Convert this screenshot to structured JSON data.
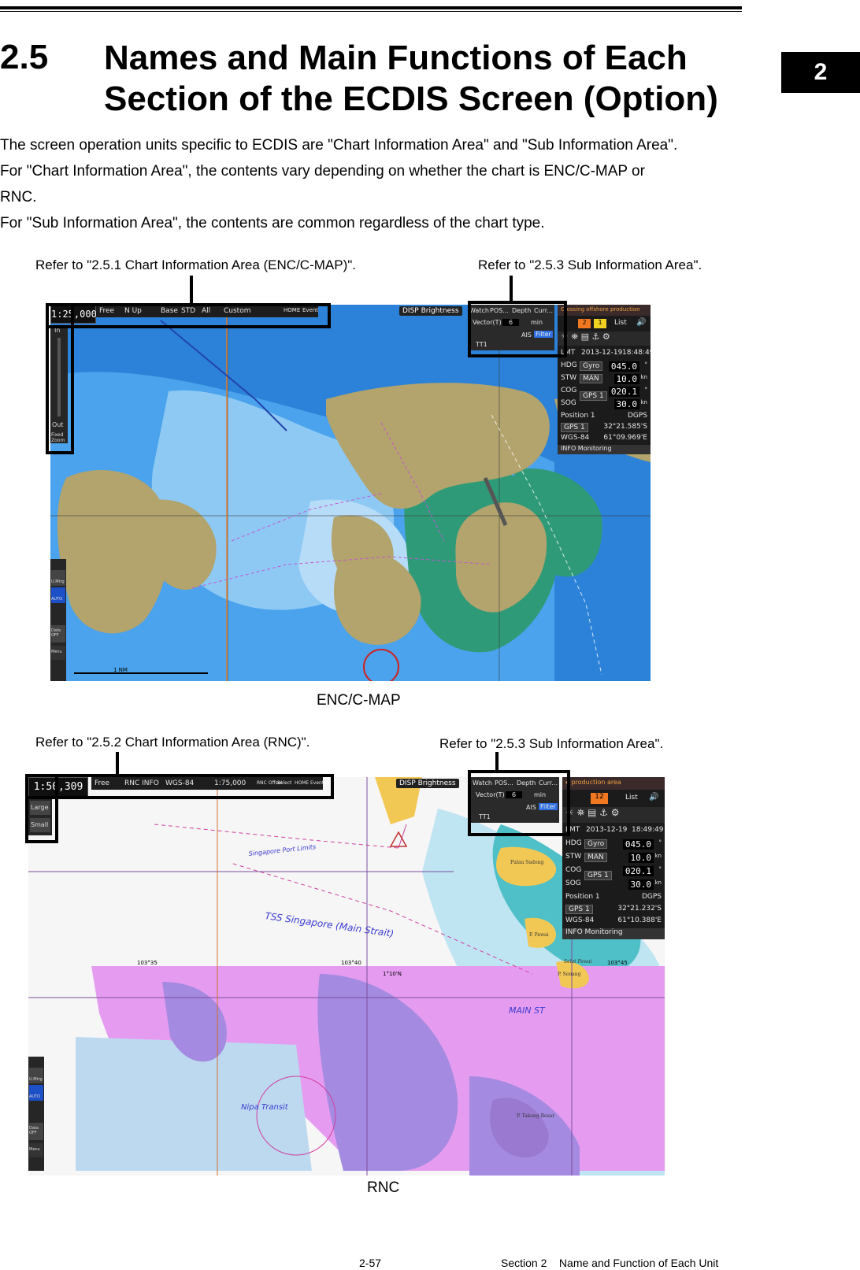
{
  "chapter_tab": "2",
  "heading": {
    "number": "2.5",
    "title": "Names and Main Functions of Each Section of the ECDIS Screen (Option)"
  },
  "paragraphs": [
    "The screen operation units specific to ECDIS are \"Chart Information Area\" and \"Sub Information Area\".",
    "For \"Chart Information Area\", the contents vary depending on whether the chart is ENC/C-MAP or",
    "RNC.",
    "For \"Sub Information Area\", the contents are common regardless of the chart type."
  ],
  "figure1": {
    "callout_left": "Refer to \"2.5.1 Chart Information Area (ENC/C-MAP)\".",
    "callout_right": "Refer to \"2.5.3 Sub Information Area\".",
    "caption": "ENC/C-MAP",
    "toolbar": {
      "scale": "1:25,000",
      "items": [
        "Free",
        "N Up",
        "Base",
        "STD",
        "All",
        "Custom"
      ],
      "icons": [
        "HOME",
        "Event"
      ]
    },
    "zoom": {
      "in": "In",
      "out": "Out",
      "fixed": "Fixed Zoom"
    },
    "brightness": "DISP Brightness",
    "alert_text": "Crossing offshore production",
    "watch": {
      "tabs": [
        "Watch",
        "POS...",
        "Depth",
        "Curr..."
      ],
      "vector": "Vector(T)",
      "vector_val": "6",
      "vector_unit": "min",
      "ais": "AIS",
      "filter": "Filter",
      "tt": "TT1"
    },
    "alarm_counts": [
      "2",
      "1"
    ],
    "list": "List",
    "sensor": {
      "time_label": "LMT",
      "date": "2013-12-19",
      "time": "18:48:49",
      "hdg_src": "Gyro",
      "hdg": "045.0",
      "hdg_u": "°",
      "stw_src": "MAN",
      "stw": "10.0",
      "stw_u": "kn",
      "cog_src": "GPS 1",
      "cog": "020.1",
      "cog_u": "°",
      "sog": "30.0",
      "sog_u": "kn",
      "pos_label": "Position 1",
      "pos_type": "DGPS",
      "gps": "GPS 1",
      "lat": "32°21.585'S",
      "datum": "WGS-84",
      "lon": "61°09.969'E",
      "info": "INFO Monitoring"
    },
    "side_buttons": [
      "U.Mtrg",
      "AUTO",
      "Data OFF",
      "Menu"
    ],
    "scalebar": "1 NM"
  },
  "figure2": {
    "callout_left": "Refer to \"2.5.2 Chart Information Area (RNC)\".",
    "callout_right": "Refer to \"2.5.3 Sub Information Area\".",
    "caption": "RNC",
    "toolbar": {
      "scale": "1:50,309",
      "items": [
        "Free",
        "RNC INFO",
        "WGS-84",
        "1:75,000"
      ],
      "icons": [
        "RNC Offset",
        "Select",
        "HOME",
        "Event"
      ]
    },
    "zoom": {
      "large": "Large",
      "small": "Small"
    },
    "brightness": "DISP Brightness",
    "alert_text": "e production area",
    "watch": {
      "tabs": [
        "Watch",
        "POS...",
        "Depth",
        "Curr..."
      ],
      "vector": "Vector(T)",
      "vector_val": "6",
      "vector_unit": "min",
      "ais": "AIS",
      "filter": "Filter",
      "tt": "TT1"
    },
    "alarm_counts": [
      "12"
    ],
    "list": "List",
    "sensor": {
      "time_label": "LMT",
      "date": "2013-12-19",
      "time": "18:49:49",
      "hdg_src": "Gyro",
      "hdg": "045.0",
      "hdg_u": "°",
      "stw_src": "MAN",
      "stw": "10.0",
      "stw_u": "kn",
      "cog_src": "GPS 1",
      "cog": "020.1",
      "cog_u": "°",
      "sog": "30.0",
      "sog_u": "kn",
      "pos_label": "Position 1",
      "pos_type": "DGPS",
      "gps": "GPS 1",
      "lat": "32°21.232'S",
      "datum": "WGS-84",
      "lon": "61°10.388'E",
      "info": "INFO Monitoring"
    },
    "map_labels": [
      "TSS Singapore (Main Strait)",
      "Singapore Port Limits",
      "Pulau Sudong",
      "P. Pawai",
      "P. Senang",
      "P. Takong Besar",
      "Selat Pawai",
      "Nipa Transit",
      "MAIN ST",
      "103°45",
      "103°40",
      "103°35",
      "1°10'N"
    ],
    "side_buttons": [
      "U.Mtrg",
      "AUTO",
      "Data OFF",
      "Menu"
    ]
  },
  "footer": {
    "page": "2-57",
    "section": "Section 2    Name and Function of Each Unit"
  },
  "colors": {
    "deep_water": "#1a6fd0",
    "mid_water": "#3d9be9",
    "shallow": "#9fd0f5",
    "land": "#b3a36c",
    "green": "#2f9a78",
    "magenta": "#e08af0"
  }
}
